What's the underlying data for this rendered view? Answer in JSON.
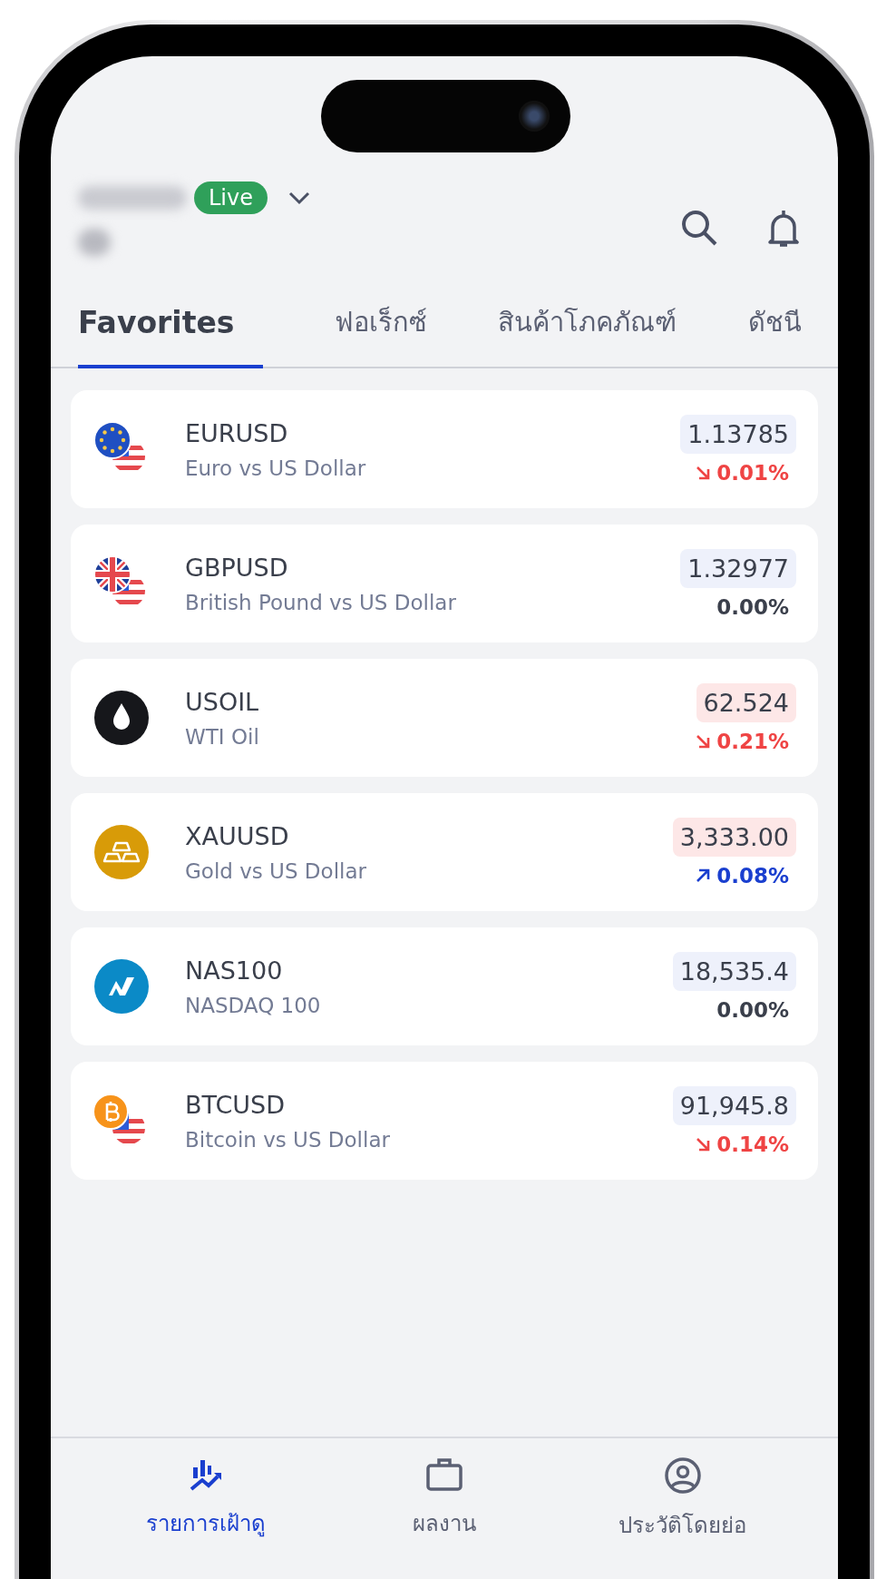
{
  "header": {
    "account_badge": "Live"
  },
  "tabs": [
    {
      "label": "Favorites",
      "selected": true
    },
    {
      "label": "ฟอเร็กซ์",
      "selected": false
    },
    {
      "label": "สินค้าโภคภัณฑ์",
      "selected": false
    },
    {
      "label": "ดัชนี",
      "selected": false
    }
  ],
  "instruments": [
    {
      "symbol": "EURUSD",
      "name": "Euro vs US Dollar",
      "price": "1.13785",
      "price_highlight": false,
      "change": "0.01%",
      "falling": true,
      "rising": false,
      "kind": "eu-us"
    },
    {
      "symbol": "GBPUSD",
      "name": "British Pound vs US Dollar",
      "price": "1.32977",
      "price_highlight": false,
      "change": "0.00%",
      "falling": false,
      "rising": false,
      "kind": "gb-us"
    },
    {
      "symbol": "USOIL",
      "name": "WTI Oil",
      "price": "62.524",
      "price_highlight": true,
      "change": "0.21%",
      "falling": true,
      "rising": false,
      "kind": "oil"
    },
    {
      "symbol": "XAUUSD",
      "name": "Gold vs US Dollar",
      "price": "3,333.00",
      "price_highlight": true,
      "change": "0.08%",
      "falling": false,
      "rising": true,
      "kind": "gold"
    },
    {
      "symbol": "NAS100",
      "name": "NASDAQ 100",
      "price": "18,535.4",
      "price_highlight": false,
      "change": "0.00%",
      "falling": false,
      "rising": false,
      "kind": "nasdaq"
    },
    {
      "symbol": "BTCUSD",
      "name": "Bitcoin vs US Dollar",
      "price": "91,945.8",
      "price_highlight": false,
      "change": "0.14%",
      "falling": true,
      "rising": false,
      "kind": "btc-us"
    }
  ],
  "bottom_nav": [
    {
      "label": "รายการเฝ้าดู",
      "selected": true,
      "kind": "watchlist"
    },
    {
      "label": "ผลงาน",
      "selected": false,
      "kind": "portfolio"
    },
    {
      "label": "ประวัติโดยย่อ",
      "selected": false,
      "kind": "profile"
    }
  ]
}
